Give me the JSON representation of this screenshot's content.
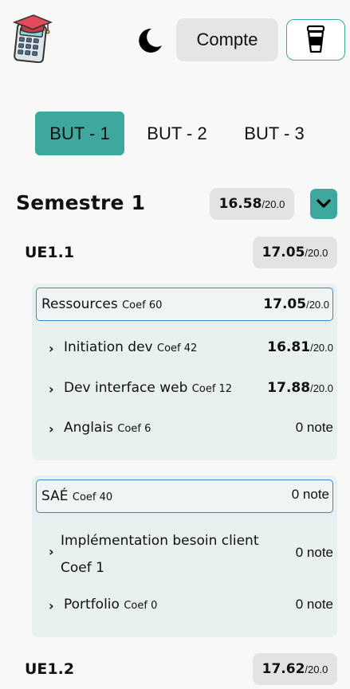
{
  "header": {
    "logo_icon": "calculator-graduation-cap-icon",
    "theme_icon": "moon-icon",
    "account_label": "Compte",
    "coffee_icon": "coffee-cup-icon"
  },
  "tabs": [
    {
      "label": "BUT - 1",
      "active": true
    },
    {
      "label": "BUT - 2",
      "active": false
    },
    {
      "label": "BUT - 3",
      "active": false
    }
  ],
  "colors": {
    "accent": "#3ea89e",
    "border_blue": "#3a87c7",
    "card_bg": "#e8f1ef"
  },
  "semestre": {
    "title": "Semestre 1",
    "grade": "16.58",
    "grade_max": "/20.0",
    "toggle_icon": "chevron-down-icon"
  },
  "ue1": {
    "title": "UE1.1",
    "grade": "17.05",
    "grade_max": "/20.0",
    "ressources": {
      "name": "Ressources",
      "coef": "Coef 60",
      "grade": "17.05",
      "grade_max": "/20.0",
      "items": [
        {
          "name": "Initiation dev",
          "coef": "Coef 42",
          "grade": "16.81",
          "grade_max": "/20.0"
        },
        {
          "name": "Dev interface web",
          "coef": "Coef 12",
          "grade": "17.88",
          "grade_max": "/20.0"
        },
        {
          "name": "Anglais",
          "coef": "Coef 6",
          "note": "0 note"
        }
      ]
    },
    "sae": {
      "name": "SAÉ",
      "coef": "Coef 40",
      "note": "0 note",
      "items": [
        {
          "name": "Implémentation besoin client",
          "coef": "Coef 1",
          "note": "0 note"
        },
        {
          "name": "Portfolio",
          "coef": "Coef 0",
          "note": "0 note"
        }
      ]
    }
  },
  "ue2": {
    "title": "UE1.2",
    "grade": "17.62",
    "grade_max": "/20.0"
  }
}
